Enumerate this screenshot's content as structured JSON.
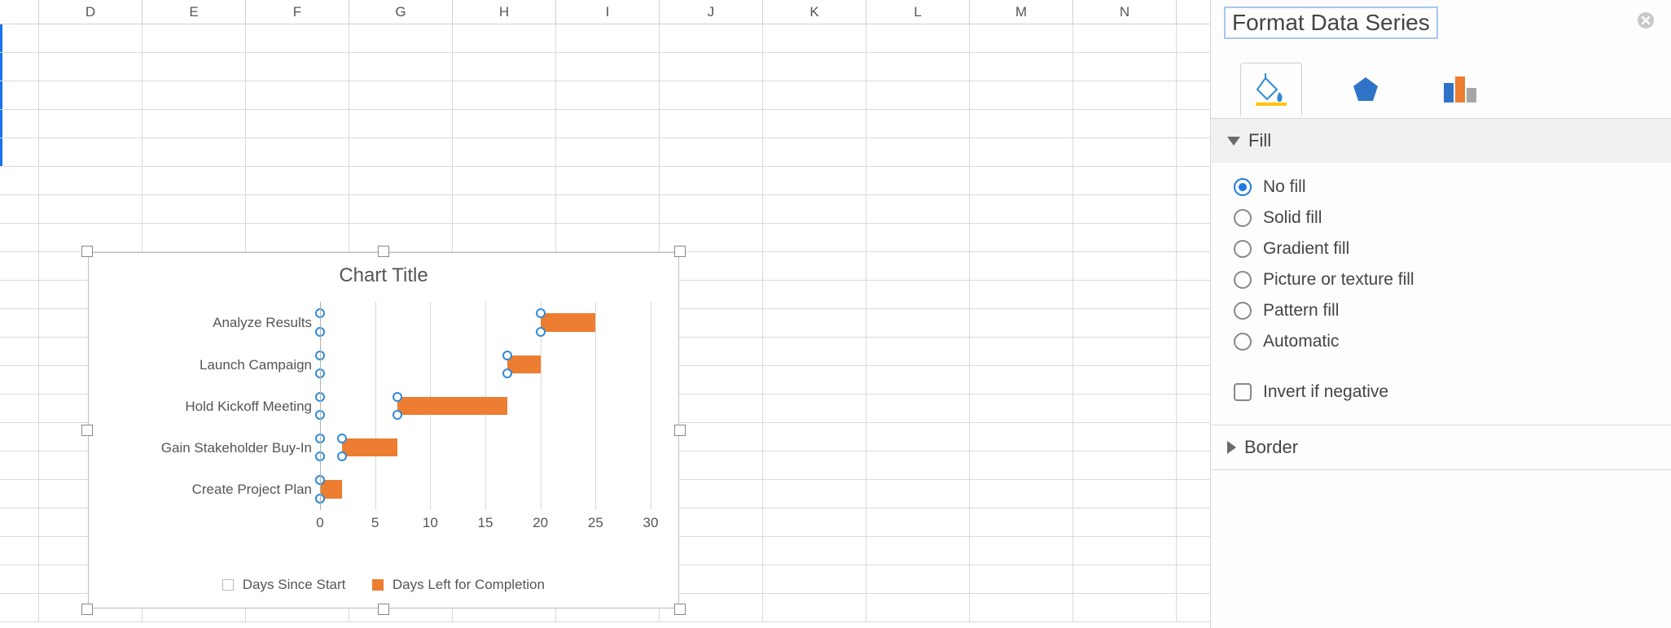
{
  "columns": [
    "D",
    "E",
    "F",
    "G",
    "H",
    "I",
    "J",
    "K",
    "L",
    "M",
    "N"
  ],
  "panel": {
    "title": "Format Data Series",
    "tabs": {
      "fill": "fill",
      "shape": "shape",
      "series": "series"
    },
    "sections": {
      "fill": {
        "label": "Fill",
        "options": {
          "no_fill": "No fill",
          "solid_fill": "Solid fill",
          "gradient_fill": "Gradient fill",
          "picture_fill": "Picture or texture fill",
          "pattern_fill": "Pattern fill",
          "automatic": "Automatic"
        },
        "invert": "Invert if negative",
        "selected": "no_fill"
      },
      "border": {
        "label": "Border"
      }
    }
  },
  "chart_data": {
    "type": "bar",
    "title": "Chart Title",
    "xlabel": "",
    "ylabel": "",
    "xlim": [
      0,
      30
    ],
    "x_ticks": [
      0,
      5,
      10,
      15,
      20,
      25,
      30
    ],
    "categories": [
      "Analyze Results",
      "Launch Campaign",
      "Hold Kickoff Meeting",
      "Gain Stakeholder Buy-In",
      "Create Project Plan"
    ],
    "series": [
      {
        "name": "Days Since Start",
        "values": [
          20,
          17,
          7,
          2,
          0
        ],
        "color": "transparent",
        "selected": true
      },
      {
        "name": "Days Left for Completion",
        "values": [
          5,
          3,
          10,
          5,
          2
        ],
        "color": "#ed7d31"
      }
    ],
    "legend_position": "bottom"
  }
}
